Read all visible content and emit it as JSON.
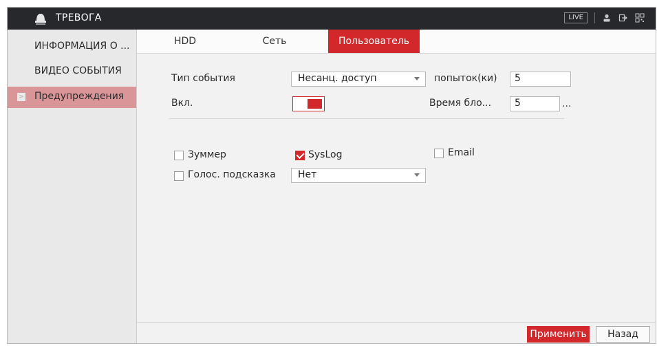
{
  "app": {
    "title": "ТРЕВОГА",
    "live_label": "LIVE"
  },
  "sidebar": {
    "items": [
      {
        "label": "ИНФОРМАЦИЯ О ..."
      },
      {
        "label": "ВИДЕО СОБЫТИЯ"
      },
      {
        "label": "Предупреждения",
        "active": true
      }
    ]
  },
  "tabs": [
    {
      "label": "HDD"
    },
    {
      "label": "Сеть"
    },
    {
      "label": "Пользователь",
      "active": true
    }
  ],
  "form": {
    "event_type_label": "Тип события",
    "event_type_value": "Несанц. доступ",
    "attempts_label": "попыток(ки)",
    "attempts_value": "5",
    "enable_label": "Вкл.",
    "enable_on": true,
    "lock_time_label": "Время бло...",
    "lock_time_value": "5",
    "lock_time_more": "..."
  },
  "actions": {
    "buzzer_label": "Зуммер",
    "buzzer_checked": false,
    "syslog_label": "SysLog",
    "syslog_checked": true,
    "email_label": "Email",
    "email_checked": false,
    "voice_label": "Голос. подсказка",
    "voice_checked": false,
    "voice_value": "Нет"
  },
  "buttons": {
    "apply": "Применить",
    "back": "Назад"
  },
  "colors": {
    "accent": "#d2282c",
    "titlebar": "#27282c",
    "sidebar_active": "#d99597"
  }
}
